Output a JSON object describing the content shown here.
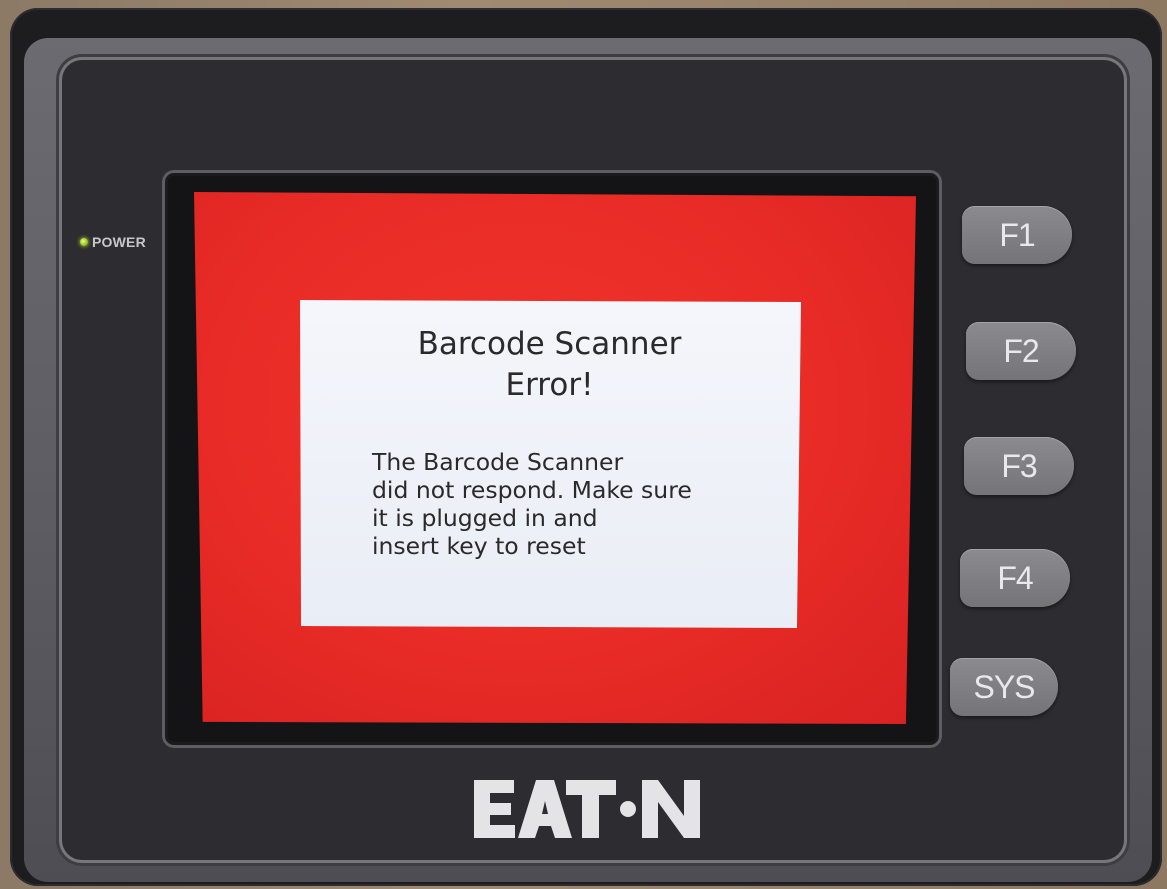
{
  "device": {
    "power_label": "POWER",
    "brand": "EATON"
  },
  "dialog": {
    "title": "Barcode Scanner\nError!",
    "message": "The Barcode Scanner\ndid not respond. Make sure\nit is plugged in and\ninsert key to reset"
  },
  "keys": {
    "f1": "F1",
    "f2": "F2",
    "f3": "F3",
    "f4": "F4",
    "sys": "SYS"
  },
  "colors": {
    "screen_background": "#e82b26",
    "dialog_background": "#eef1f7",
    "bezel": "#2c2c31",
    "key": "#808085",
    "power_led": "#a6d41e"
  }
}
